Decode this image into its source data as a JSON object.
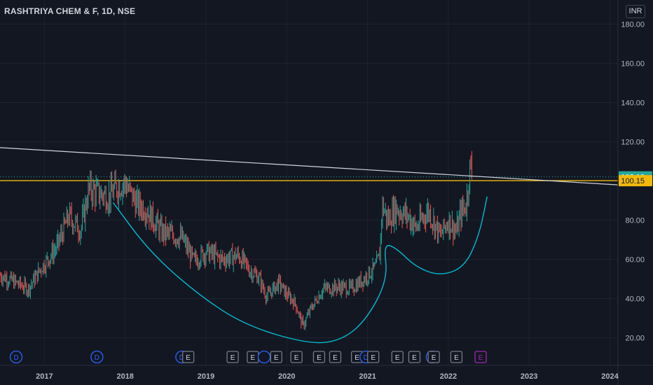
{
  "header": {
    "title": "RASHTRIYA CHEM & F, 1D, NSE",
    "currency": "INR"
  },
  "colors": {
    "background": "#131722",
    "up_candle": "#26a69a",
    "down_candle": "#ef5350",
    "price_label_bg": "#26a69a",
    "horizontal_line": "#f0b90b",
    "trendline": "#d1d4dc",
    "cup_curve": "#00bcd4",
    "dividend_marker": "#2962ff",
    "earnings_marker": "#787b86",
    "upcoming_earnings_marker": "#9c27b0"
  },
  "chart_data": {
    "type": "candlestick",
    "title": "RASHTRIYA CHEM & F, 1D, NSE",
    "x_ticks": [
      "2017",
      "2018",
      "2019",
      "2020",
      "2021",
      "2022",
      "2023",
      "2024"
    ],
    "y_ticks": [
      "20.00",
      "40.00",
      "60.00",
      "80.00",
      "100.00",
      "120.00",
      "140.00",
      "160.00",
      "180.00"
    ],
    "ylim": [
      10,
      185
    ],
    "xlim": [
      2016.45,
      2024.1
    ],
    "last_price": "102.10",
    "horizontal_level": "100.15",
    "price_path": [
      [
        2016.45,
        52
      ],
      [
        2016.6,
        49
      ],
      [
        2016.8,
        45
      ],
      [
        2016.95,
        55
      ],
      [
        2017.15,
        66
      ],
      [
        2017.3,
        82
      ],
      [
        2017.45,
        75
      ],
      [
        2017.55,
        96
      ],
      [
        2017.65,
        94
      ],
      [
        2017.8,
        92
      ],
      [
        2017.9,
        97
      ],
      [
        2018.0,
        99
      ],
      [
        2018.05,
        95
      ],
      [
        2018.15,
        88
      ],
      [
        2018.25,
        86
      ],
      [
        2018.45,
        74
      ],
      [
        2018.7,
        71
      ],
      [
        2018.85,
        59
      ],
      [
        2019.0,
        64
      ],
      [
        2019.2,
        60
      ],
      [
        2019.4,
        62
      ],
      [
        2019.55,
        54
      ],
      [
        2019.65,
        51
      ],
      [
        2019.75,
        41
      ],
      [
        2019.9,
        48
      ],
      [
        2020.0,
        42
      ],
      [
        2020.1,
        38
      ],
      [
        2020.2,
        26
      ],
      [
        2020.3,
        35
      ],
      [
        2020.45,
        45
      ],
      [
        2020.65,
        46
      ],
      [
        2020.8,
        45
      ],
      [
        2020.95,
        50
      ],
      [
        2021.1,
        56
      ],
      [
        2021.15,
        62
      ],
      [
        2021.18,
        88
      ],
      [
        2021.25,
        80
      ],
      [
        2021.35,
        86
      ],
      [
        2021.5,
        82
      ],
      [
        2021.6,
        76
      ],
      [
        2021.75,
        85
      ],
      [
        2021.9,
        72
      ],
      [
        2022.0,
        80
      ],
      [
        2022.1,
        74
      ],
      [
        2022.15,
        83
      ],
      [
        2022.22,
        88
      ],
      [
        2022.27,
        108
      ],
      [
        2022.3,
        102
      ]
    ],
    "trendline": [
      [
        2016.45,
        117
      ],
      [
        2024.1,
        98
      ]
    ],
    "cup_curve": [
      [
        2017.85,
        89
      ],
      [
        2018.3,
        64
      ],
      [
        2018.9,
        42
      ],
      [
        2019.5,
        26
      ],
      [
        2020.3,
        16.5
      ],
      [
        2020.7,
        19
      ],
      [
        2021.0,
        30
      ],
      [
        2021.25,
        50
      ],
      [
        2021.2,
        68
      ],
      [
        2021.35,
        66
      ],
      [
        2021.6,
        56
      ],
      [
        2021.9,
        51.5
      ],
      [
        2022.2,
        56
      ],
      [
        2022.38,
        72
      ],
      [
        2022.48,
        92
      ]
    ],
    "event_markers": [
      {
        "label": "D",
        "x": 2016.65,
        "kind": "dividend"
      },
      {
        "label": "D",
        "x": 2017.65,
        "kind": "dividend"
      },
      {
        "label": "D",
        "x": 2018.7,
        "kind": "dividend"
      },
      {
        "label": "E",
        "x": 2018.78,
        "kind": "earnings"
      },
      {
        "label": "E",
        "x": 2019.33,
        "kind": "earnings"
      },
      {
        "label": "E",
        "x": 2019.58,
        "kind": "earnings"
      },
      {
        "label": "",
        "x": 2019.72,
        "kind": "dividend"
      },
      {
        "label": "E",
        "x": 2019.87,
        "kind": "earnings"
      },
      {
        "label": "E",
        "x": 2020.12,
        "kind": "earnings"
      },
      {
        "label": "E",
        "x": 2020.4,
        "kind": "earnings"
      },
      {
        "label": "E",
        "x": 2020.6,
        "kind": "earnings"
      },
      {
        "label": "E",
        "x": 2020.87,
        "kind": "earnings"
      },
      {
        "label": "D",
        "x": 2020.98,
        "kind": "dividend"
      },
      {
        "label": "E",
        "x": 2021.07,
        "kind": "earnings"
      },
      {
        "label": "E",
        "x": 2021.37,
        "kind": "earnings"
      },
      {
        "label": "E",
        "x": 2021.58,
        "kind": "earnings"
      },
      {
        "label": "",
        "x": 2021.8,
        "kind": "dividend"
      },
      {
        "label": "E",
        "x": 2021.82,
        "kind": "earnings"
      },
      {
        "label": "E",
        "x": 2022.1,
        "kind": "earnings"
      },
      {
        "label": "E",
        "x": 2022.4,
        "kind": "upcoming"
      }
    ]
  }
}
